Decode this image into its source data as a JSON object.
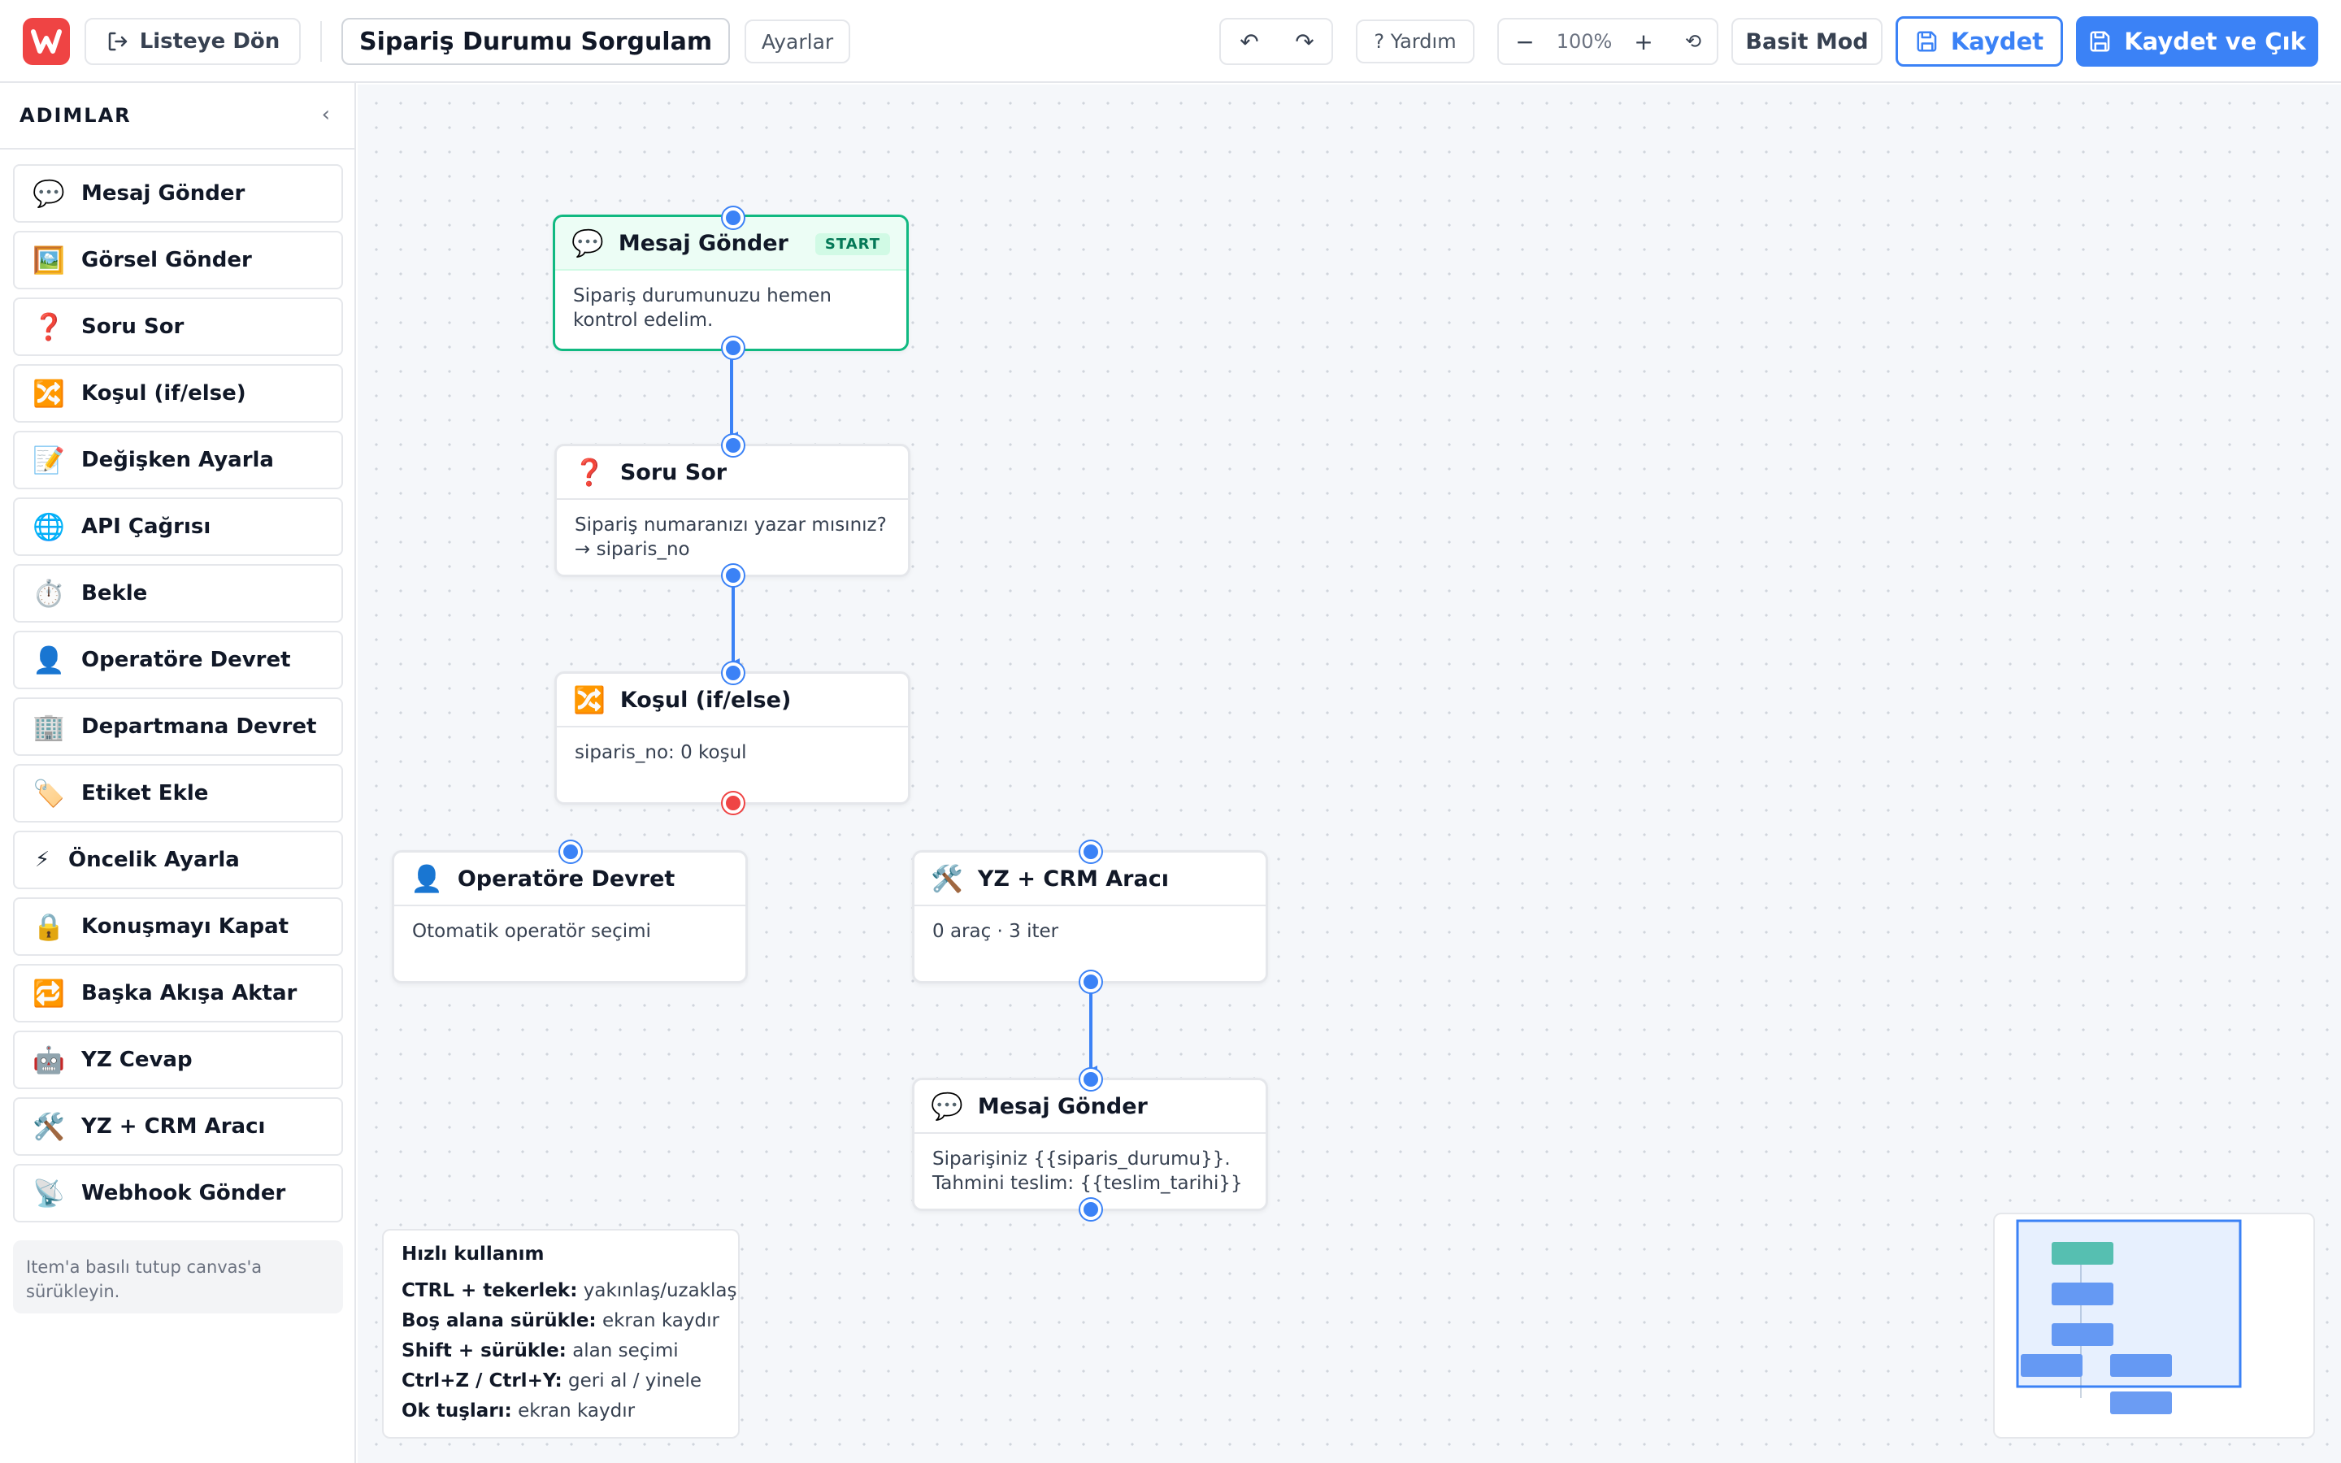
{
  "header": {
    "back_label": "Listeye Dön",
    "flow_name": "Sipariş Durumu Sorgulama",
    "settings_label": "Ayarlar",
    "help_label": "? Yardım",
    "zoom": "100%",
    "simple_mode_label": "Basit Mod",
    "save_label": "Kaydet",
    "save_exit_label": "Kaydet ve Çık",
    "undo_symbol": "↶",
    "redo_symbol": "↷",
    "zoom_out_symbol": "−",
    "zoom_in_symbol": "+",
    "reset_symbol": "⟲"
  },
  "sidebar": {
    "title": "ADIMLAR",
    "collapse_symbol": "‹",
    "items": [
      {
        "icon": "💬",
        "label": "Mesaj Gönder",
        "icon_name": "chat-bubble-icon"
      },
      {
        "icon": "🖼️",
        "label": "Görsel Gönder",
        "icon_name": "image-icon"
      },
      {
        "icon": "❓",
        "label": "Soru Sor",
        "icon_name": "question-icon"
      },
      {
        "icon": "🔀",
        "label": "Koşul (if/else)",
        "icon_name": "shuffle-icon"
      },
      {
        "icon": "📝",
        "label": "Değişken Ayarla",
        "icon_name": "memo-icon"
      },
      {
        "icon": "🌐",
        "label": "API Çağrısı",
        "icon_name": "globe-icon"
      },
      {
        "icon": "⏱️",
        "label": "Bekle",
        "icon_name": "stopwatch-icon"
      },
      {
        "icon": "👤",
        "label": "Operatöre Devret",
        "icon_name": "person-icon"
      },
      {
        "icon": "🏢",
        "label": "Departmana Devret",
        "icon_name": "building-icon"
      },
      {
        "icon": "🏷️",
        "label": "Etiket Ekle",
        "icon_name": "tag-icon"
      },
      {
        "icon": "⚡",
        "label": "Öncelik Ayarla",
        "icon_name": "lightning-icon"
      },
      {
        "icon": "🔒",
        "label": "Konuşmayı Kapat",
        "icon_name": "lock-icon"
      },
      {
        "icon": "🔁",
        "label": "Başka Akışa Aktar",
        "icon_name": "repeat-icon"
      },
      {
        "icon": "🤖",
        "label": "YZ Cevap",
        "icon_name": "robot-icon"
      },
      {
        "icon": "🛠️",
        "label": "YZ + CRM Aracı",
        "icon_name": "tools-icon"
      },
      {
        "icon": "📡",
        "label": "Webhook Gönder",
        "icon_name": "satellite-icon"
      }
    ],
    "hint": "Item'a basılı tutup canvas'a sürükleyin."
  },
  "nodes": [
    {
      "id": "n1",
      "icon": "💬",
      "title": "Mesaj Gönder",
      "body": "Sipariş durumunuzu hemen kontrol edelim.",
      "badge": "START"
    },
    {
      "id": "n2",
      "icon": "❓",
      "title": "Soru Sor",
      "body": "Sipariş numaranızı yazar mısınız?",
      "body2": "→ siparis_no"
    },
    {
      "id": "n3",
      "icon": "🔀",
      "title": "Koşul (if/else)",
      "body": "siparis_no: 0 koşul"
    },
    {
      "id": "n4",
      "icon": "👤",
      "title": "Operatöre Devret",
      "body": "Otomatik operatör seçimi"
    },
    {
      "id": "n5",
      "icon": "🛠️",
      "title": "YZ + CRM Aracı",
      "body": "0 araç · 3 iter"
    },
    {
      "id": "n6",
      "icon": "💬",
      "title": "Mesaj Gönder",
      "body": "Siparişiniz {{siparis_durumu}}.",
      "body2": "Tahmini teslim: {{teslim_tarihi}}"
    }
  ],
  "quick_help": {
    "title": "Hızlı kullanım",
    "rows": [
      {
        "key": "CTRL + tekerlek:",
        "desc": "yakınlaş/uzaklaş"
      },
      {
        "key": "Boş alana sürükle:",
        "desc": "ekran kaydır"
      },
      {
        "key": "Shift + sürükle:",
        "desc": "alan seçimi"
      },
      {
        "key": "Ctrl+Z / Ctrl+Y:",
        "desc": "geri al / yinele"
      },
      {
        "key": "Ok tuşları:",
        "desc": "ekran kaydır"
      }
    ]
  },
  "colors": {
    "accent": "#3b82f6",
    "start": "#10b981",
    "brand": "#ef4444",
    "condition_false": "#ef4444"
  }
}
